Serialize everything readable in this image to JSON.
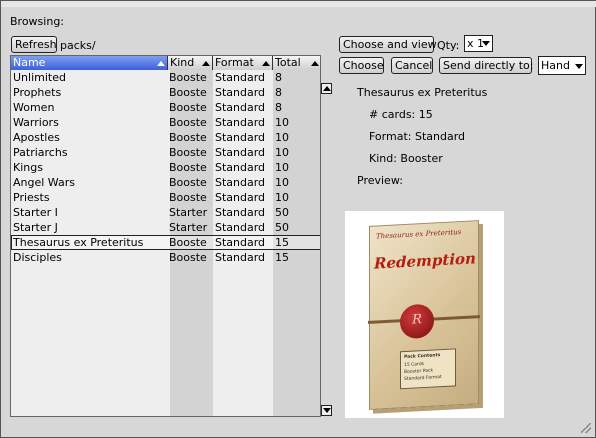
{
  "browser": {
    "title": "Browsing:",
    "refresh_label": "Refresh",
    "path": "packs/"
  },
  "table": {
    "columns": [
      "Name",
      "Kind",
      "Format",
      "Total"
    ],
    "rows": [
      {
        "name": "Unlimited",
        "kind": "Booste",
        "format": "Standard",
        "total": "8"
      },
      {
        "name": "Prophets",
        "kind": "Booste",
        "format": "Standard",
        "total": "8"
      },
      {
        "name": "Women",
        "kind": "Booste",
        "format": "Standard",
        "total": "8"
      },
      {
        "name": "Warriors",
        "kind": "Booste",
        "format": "Standard",
        "total": "10"
      },
      {
        "name": "Apostles",
        "kind": "Booste",
        "format": "Standard",
        "total": "10"
      },
      {
        "name": "Patriarchs",
        "kind": "Booste",
        "format": "Standard",
        "total": "10"
      },
      {
        "name": "Kings",
        "kind": "Booste",
        "format": "Standard",
        "total": "10"
      },
      {
        "name": "Angel Wars",
        "kind": "Booste",
        "format": "Standard",
        "total": "10"
      },
      {
        "name": "Priests",
        "kind": "Booste",
        "format": "Standard",
        "total": "10"
      },
      {
        "name": "Starter I",
        "kind": "Starter",
        "format": "Standard",
        "total": "50"
      },
      {
        "name": "Starter J",
        "kind": "Starter",
        "format": "Standard",
        "total": "50"
      },
      {
        "name": "Thesaurus ex Preteritus",
        "kind": "Booste",
        "format": "Standard",
        "total": "15"
      },
      {
        "name": "Disciples",
        "kind": "Booste",
        "format": "Standard",
        "total": "15"
      }
    ],
    "selected_index": 11
  },
  "actions": {
    "choose_and_view": "Choose and view",
    "qty_label": "Qty:",
    "qty_value": "x 1",
    "choose": "Choose",
    "cancel": "Cancel",
    "send_directly": "Send directly to:",
    "destination": "Hand"
  },
  "details": {
    "title": "Thesaurus ex Preteritus",
    "cards": "# cards: 15",
    "format": "Format: Standard",
    "kind": "Kind: Booster",
    "preview_label": "Preview:"
  },
  "preview_image": {
    "top_text": "Thesaurus ex Preteritus",
    "logo_text": "Redemption",
    "seal_letter": "R",
    "pack_lines": [
      "Pack Contents",
      "15 Cards",
      "Booster Pack",
      "Standard Format"
    ]
  },
  "colors": {
    "header_active": "#3d5fd8",
    "dialog_bg": "#d7d7d7",
    "table_bg": "#eeeeee",
    "accent_red": "#b31d12"
  }
}
